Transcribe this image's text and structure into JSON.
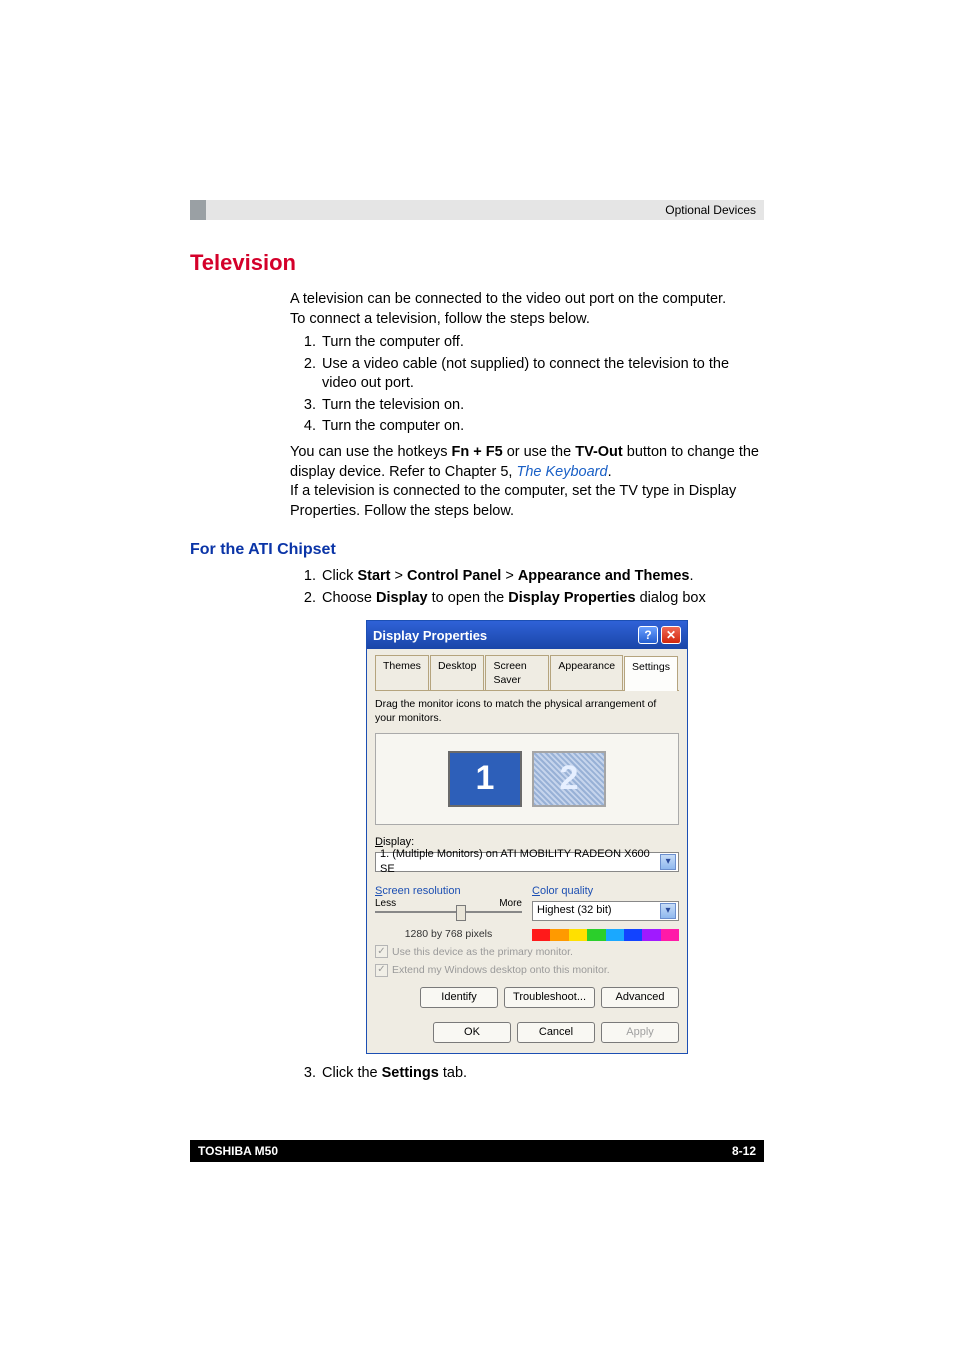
{
  "header": {
    "chapter_label": "Optional Devices"
  },
  "section": {
    "title": "Television",
    "intro1": "A television can be connected to the video out port on the computer.",
    "intro2": "To connect a television, follow the steps below.",
    "steps": [
      "Turn the computer off.",
      "Use a video cable (not supplied) to connect the television to the video out port.",
      "Turn the television on.",
      "Turn the computer on."
    ],
    "hotkey_pre": "You can use the hotkeys ",
    "hotkey_bold1": "Fn + F5",
    "hotkey_mid": " or use the ",
    "hotkey_bold2": "TV-Out",
    "hotkey_post": " button to change the display device. Refer to Chapter 5, ",
    "hotkey_link": "The Keyboard",
    "hotkey_end": ".",
    "tv_note": "If a television is connected to the computer, set the TV type in Display Properties. Follow the steps below."
  },
  "subsection": {
    "title": "For the ATI Chipset",
    "step1_pre": "Click ",
    "step1_b1": "Start",
    "step1_sep": " > ",
    "step1_b2": "Control Panel",
    "step1_b3": "Appearance and Themes",
    "step1_end": ".",
    "step2_pre": "Choose ",
    "step2_b1": "Display",
    "step2_mid": " to open the ",
    "step2_b2": "Display Properties",
    "step2_end": " dialog box",
    "step3_pre": "Click the ",
    "step3_b1": "Settings",
    "step3_end": " tab."
  },
  "dialog": {
    "title": "Display Properties",
    "tabs": [
      "Themes",
      "Desktop",
      "Screen Saver",
      "Appearance",
      "Settings"
    ],
    "active_tab_index": 4,
    "hint": "Drag the monitor icons to match the physical arrangement of your monitors.",
    "monitors": {
      "primary": "1",
      "secondary": "2"
    },
    "display_label_u": "D",
    "display_label_rest": "isplay:",
    "display_value": "1. (Multiple Monitors) on ATI MOBILITY RADEON X600 SE",
    "screen_res_u": "S",
    "screen_res_rest": "creen resolution",
    "less": "Less",
    "more": "More",
    "res_value": "1280 by 768 pixels",
    "color_q_u": "C",
    "color_q_rest": "olor quality",
    "color_value": "Highest (32 bit)",
    "chk1_u": "U",
    "chk1_rest": "se this device as the primary monitor.",
    "chk2_u": "E",
    "chk2_rest": "xtend my Windows desktop onto this monitor.",
    "btn_identify": "Identify",
    "btn_trouble_u": "T",
    "btn_trouble_rest": "roubleshoot...",
    "btn_adv_pre": "Ad",
    "btn_adv_u": "v",
    "btn_adv_rest": "anced",
    "btn_ok": "OK",
    "btn_cancel": "Cancel",
    "btn_apply_u": "A",
    "btn_apply_rest": "pply"
  },
  "footer": {
    "left": "TOSHIBA M50",
    "right": "8-12"
  }
}
